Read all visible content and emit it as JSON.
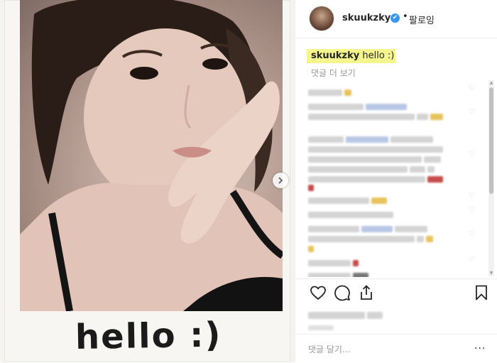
{
  "post": {
    "handwriting": "hello :)"
  },
  "header": {
    "username": "skuukzky",
    "verified_glyph": "✔",
    "separator": "•",
    "follow_label": "팔로잉"
  },
  "caption": {
    "username": "skuukzky",
    "text": "hello :)"
  },
  "view_more_comments": "댓글 더 보기",
  "comment_input": {
    "placeholder": "댓글 달기..."
  },
  "comment_menu_glyph": "···",
  "icons": {
    "like": "heart-icon",
    "comment": "comment-icon",
    "share": "share-icon",
    "save": "bookmark-icon",
    "next": "chevron-right-icon"
  },
  "colors": {
    "highlight": "#f5f58e",
    "verified": "#3897f0",
    "text": "#262626",
    "muted": "#999999"
  }
}
